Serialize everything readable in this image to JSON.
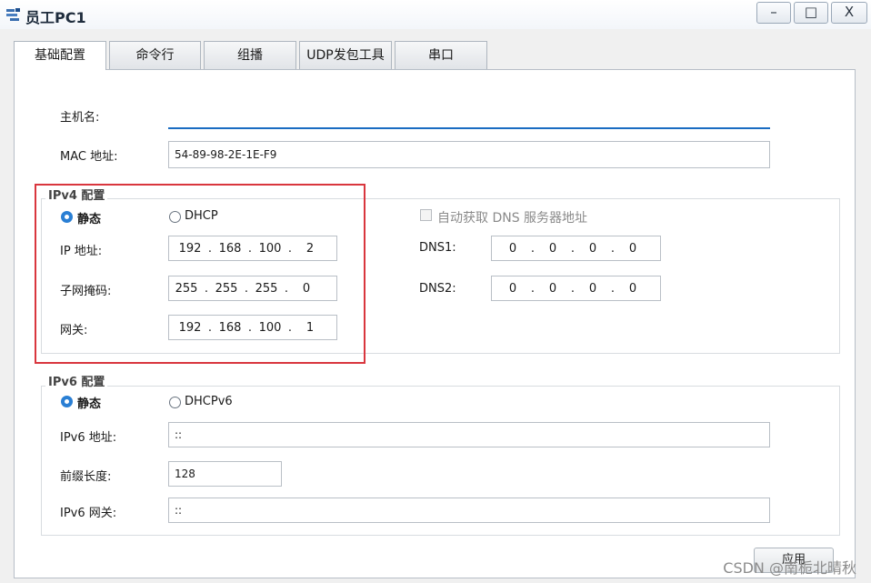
{
  "window": {
    "title": "员工PC1",
    "minimize_glyph": "–",
    "maximize_glyph": "□",
    "close_glyph": "X"
  },
  "tabs": [
    {
      "label": "基础配置",
      "active": true
    },
    {
      "label": "命令行",
      "active": false
    },
    {
      "label": "组播",
      "active": false
    },
    {
      "label": "UDP发包工具",
      "active": false
    },
    {
      "label": "串口",
      "active": false
    }
  ],
  "host": {
    "hostname_label": "主机名:",
    "hostname_value": "",
    "mac_label": "MAC 地址:",
    "mac_value": "54-89-98-2E-1E-F9"
  },
  "ipv4": {
    "group_title": "IPv4 配置",
    "static_label": "静态",
    "dhcp_label": "DHCP",
    "mode": "static",
    "ip_label": "IP 地址:",
    "ip": [
      "192",
      "168",
      "100",
      "2"
    ],
    "mask_label": "子网掩码:",
    "mask": [
      "255",
      "255",
      "255",
      "0"
    ],
    "gateway_label": "网关:",
    "gateway": [
      "192",
      "168",
      "100",
      "1"
    ],
    "auto_dns_label": "自动获取 DNS 服务器地址",
    "auto_dns_checked": false,
    "dns1_label": "DNS1:",
    "dns1": [
      "0",
      "0",
      "0",
      "0"
    ],
    "dns2_label": "DNS2:",
    "dns2": [
      "0",
      "0",
      "0",
      "0"
    ]
  },
  "ipv6": {
    "group_title": "IPv6 配置",
    "static_label": "静态",
    "dhcp_label": "DHCPv6",
    "mode": "static",
    "addr_label": "IPv6 地址:",
    "addr_value": "::",
    "prefix_label": "前缀长度:",
    "prefix_value": "128",
    "gateway_label": "IPv6 网关:",
    "gateway_value": "::"
  },
  "apply_label": "应用",
  "watermark": "CSDN @南栀北晴秋",
  "colors": {
    "highlight_box": "#d9363e",
    "focus_underline": "#1a6cc2",
    "radio_selected": "#2a7fd4"
  }
}
